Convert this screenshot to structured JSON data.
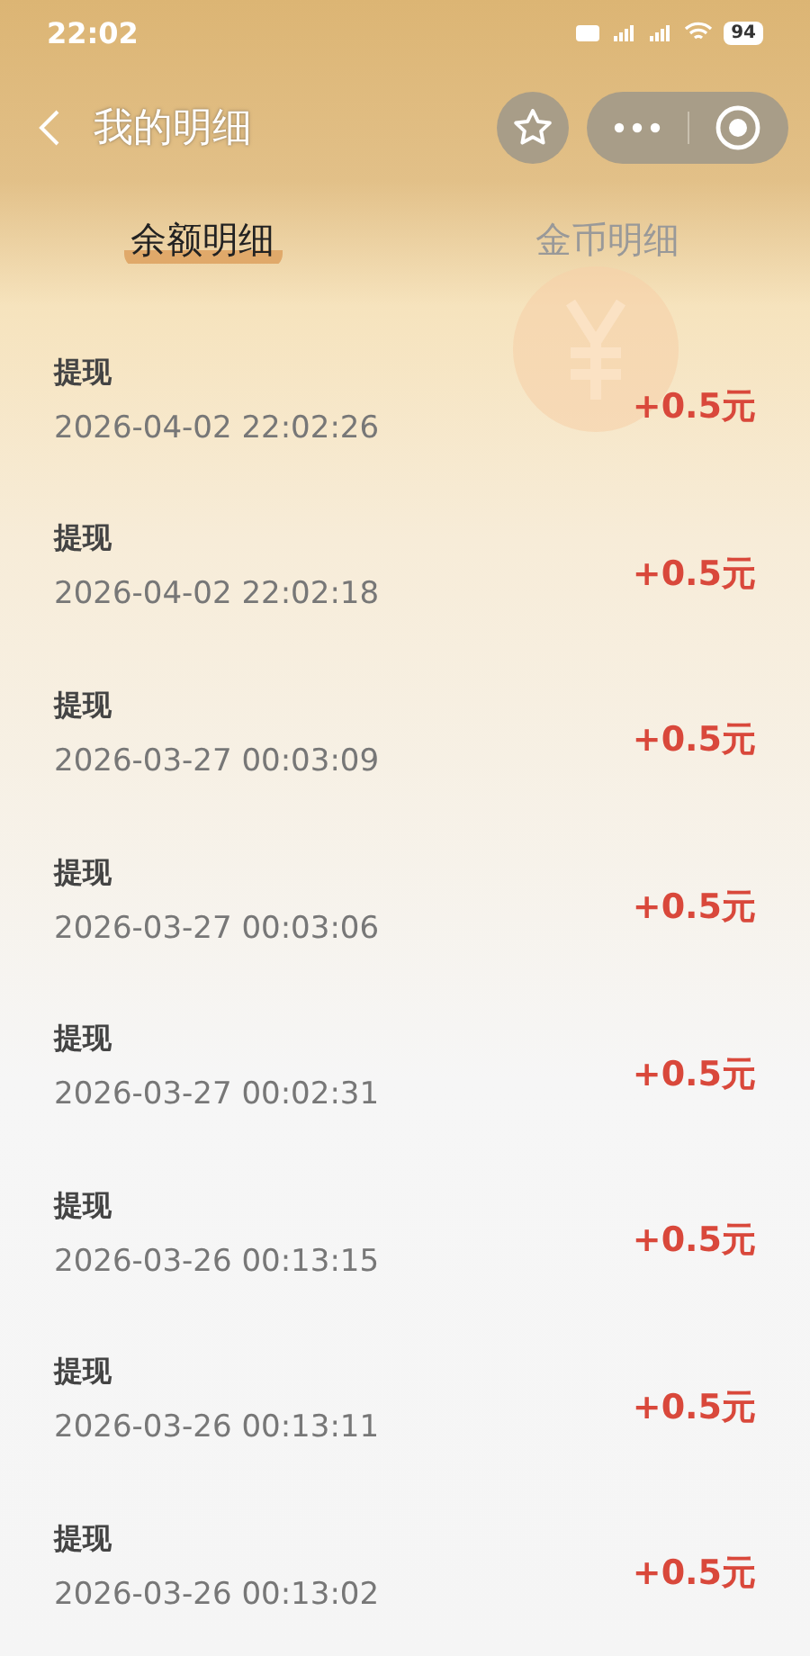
{
  "status_bar": {
    "time": "22:02",
    "battery": "94"
  },
  "header": {
    "title": "我的明细"
  },
  "tabs": [
    {
      "label": "余额明细",
      "selected": true
    },
    {
      "label": "金币明细",
      "selected": false
    }
  ],
  "records": [
    {
      "title": "提现",
      "time": "2026-04-02 22:02:26",
      "amount": "+0.5元"
    },
    {
      "title": "提现",
      "time": "2026-04-02 22:02:18",
      "amount": "+0.5元"
    },
    {
      "title": "提现",
      "time": "2026-03-27 00:03:09",
      "amount": "+0.5元"
    },
    {
      "title": "提现",
      "time": "2026-03-27 00:03:06",
      "amount": "+0.5元"
    },
    {
      "title": "提现",
      "time": "2026-03-27 00:02:31",
      "amount": "+0.5元"
    },
    {
      "title": "提现",
      "time": "2026-03-26 00:13:15",
      "amount": "+0.5元"
    },
    {
      "title": "提现",
      "time": "2026-03-26 00:13:11",
      "amount": "+0.5元"
    },
    {
      "title": "提现",
      "time": "2026-03-26 00:13:02",
      "amount": "+0.5元"
    }
  ]
}
